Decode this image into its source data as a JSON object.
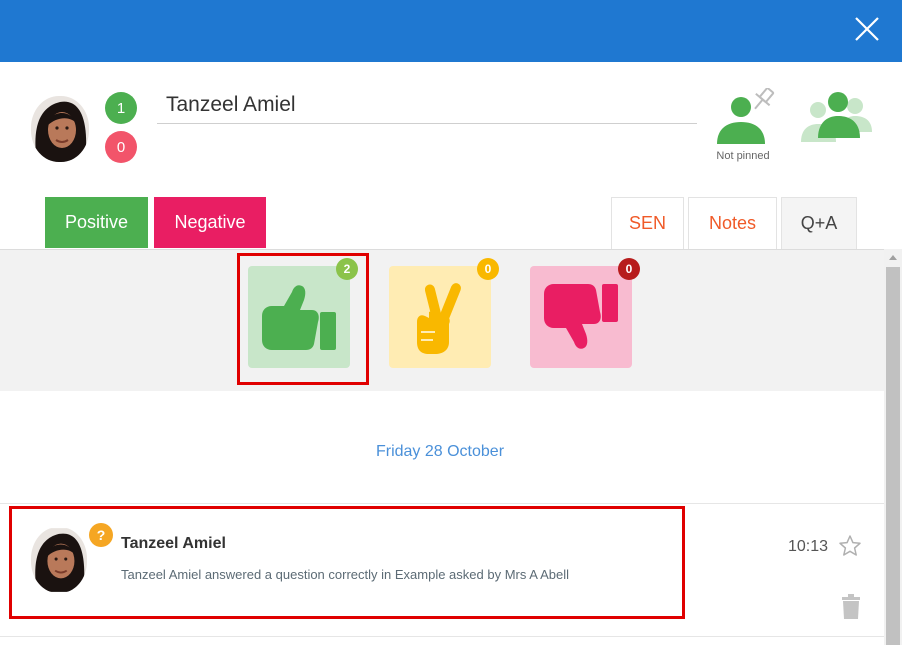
{
  "student": {
    "name": "Tanzeel Amiel",
    "positive_count": "1",
    "negative_count": "0"
  },
  "pin": {
    "label": "Not pinned"
  },
  "tabs": {
    "positive": "Positive",
    "negative": "Negative",
    "sen": "SEN",
    "notes": "Notes",
    "qa": "Q+A"
  },
  "icons": [
    {
      "icon": "thumbs-up-icon",
      "count": "2",
      "color": "#4caf50"
    },
    {
      "icon": "crossed-fingers-icon",
      "count": "0",
      "color": "#f9b800"
    },
    {
      "icon": "thumbs-down-icon",
      "count": "0",
      "color": "#e91e63"
    }
  ],
  "feed": {
    "date": "Friday 28 October",
    "items": [
      {
        "name": "Tanzeel Amiel",
        "description": "Tanzeel Amiel answered a question correctly in Example asked by Mrs A Abell",
        "time": "10:13",
        "badge": "?"
      }
    ]
  },
  "colors": {
    "header": "#1f78d1",
    "positive": "#4caf50",
    "negative": "#e91e63",
    "accent_orange": "#f05a28",
    "highlight": "#e00000"
  }
}
